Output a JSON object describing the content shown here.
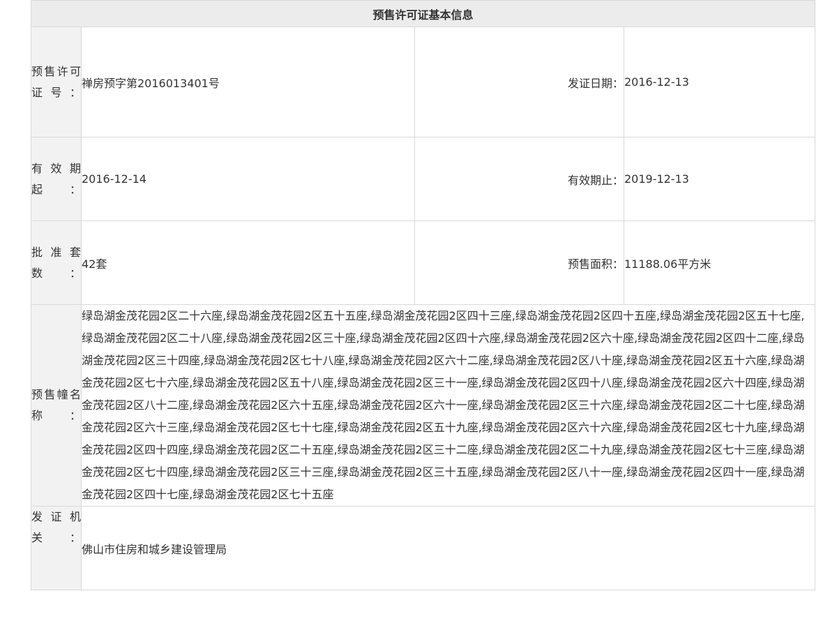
{
  "table": {
    "title": "预售许可证基本信息",
    "rows": [
      {
        "label": "预售许可证号：",
        "value": "禅房预字第2016013401号",
        "right_label": "发证日期：",
        "right_value": "2016-12-13"
      },
      {
        "label": "有效期起：",
        "value": "2016-12-14",
        "right_label": "有效期止：",
        "right_value": "2019-12-13"
      },
      {
        "label": "批准套数：",
        "value": "42套",
        "right_label": "预售面积：",
        "right_value": "11188.06平方米"
      }
    ],
    "buildings": {
      "label": "预售幢名称：",
      "value": "绿岛湖金茂花园2区二十六座,绿岛湖金茂花园2区五十五座,绿岛湖金茂花园2区四十三座,绿岛湖金茂花园2区四十五座,绿岛湖金茂花园2区五十七座,绿岛湖金茂花园2区二十八座,绿岛湖金茂花园2区三十座,绿岛湖金茂花园2区四十六座,绿岛湖金茂花园2区六十座,绿岛湖金茂花园2区四十二座,绿岛湖金茂花园2区三十四座,绿岛湖金茂花园2区七十八座,绿岛湖金茂花园2区六十二座,绿岛湖金茂花园2区八十座,绿岛湖金茂花园2区五十六座,绿岛湖金茂花园2区七十六座,绿岛湖金茂花园2区五十八座,绿岛湖金茂花园2区三十一座,绿岛湖金茂花园2区四十八座,绿岛湖金茂花园2区六十四座,绿岛湖金茂花园2区八十二座,绿岛湖金茂花园2区六十五座,绿岛湖金茂花园2区六十一座,绿岛湖金茂花园2区三十六座,绿岛湖金茂花园2区二十七座,绿岛湖金茂花园2区六十三座,绿岛湖金茂花园2区七十七座,绿岛湖金茂花园2区五十九座,绿岛湖金茂花园2区六十六座,绿岛湖金茂花园2区七十九座,绿岛湖金茂花园2区四十四座,绿岛湖金茂花园2区二十五座,绿岛湖金茂花园2区三十二座,绿岛湖金茂花园2区二十九座,绿岛湖金茂花园2区七十三座,绿岛湖金茂花园2区七十四座,绿岛湖金茂花园2区三十三座,绿岛湖金茂花园2区三十五座,绿岛湖金茂花园2区八十一座,绿岛湖金茂花园2区四十一座,绿岛湖金茂花园2区四十七座,绿岛湖金茂花园2区七十五座"
    },
    "issuer": {
      "label": "发证机关：",
      "value": "佛山市住房和城乡建设管理局"
    }
  }
}
